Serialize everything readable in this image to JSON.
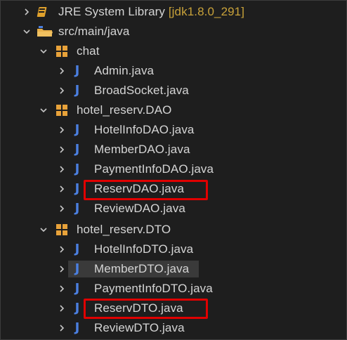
{
  "tree": {
    "library": {
      "label": "JRE System Library",
      "suffix": "[jdk1.8.0_291]"
    },
    "src_folder": {
      "label": "src/main/java"
    },
    "packages": [
      {
        "name": "chat",
        "files": [
          "Admin.java",
          "BroadSocket.java"
        ]
      },
      {
        "name": "hotel_reserv.DAO",
        "files": [
          "HotelInfoDAO.java",
          "MemberDAO.java",
          "PaymentInfoDAO.java",
          "ReservDAO.java",
          "ReviewDAO.java"
        ]
      },
      {
        "name": "hotel_reserv.DTO",
        "files": [
          "HotelInfoDTO.java",
          "MemberDTO.java",
          "PaymentInfoDTO.java",
          "ReservDTO.java",
          "ReviewDTO.java"
        ]
      }
    ],
    "java_icon_glyph": "J",
    "selected_file": "MemberDTO.java",
    "highlighted_files": [
      "ReservDAO.java",
      "ReservDTO.java"
    ]
  },
  "colors": {
    "background": "#1e1e1e",
    "text": "#d4d4d4",
    "library_suffix": "#c8a23a",
    "java_icon": "#4b7fe0",
    "package_icon": "#e8a23a",
    "folder_icon": "#e8b04a",
    "highlight_box": "#e00000",
    "selection": "#3a3a3a"
  },
  "icons": {
    "library": "library-book-icon",
    "source_folder": "source-folder-icon",
    "package": "package-icon",
    "java_file": "java-file-icon",
    "collapsed": "chevron-right-icon",
    "expanded": "chevron-down-icon"
  }
}
